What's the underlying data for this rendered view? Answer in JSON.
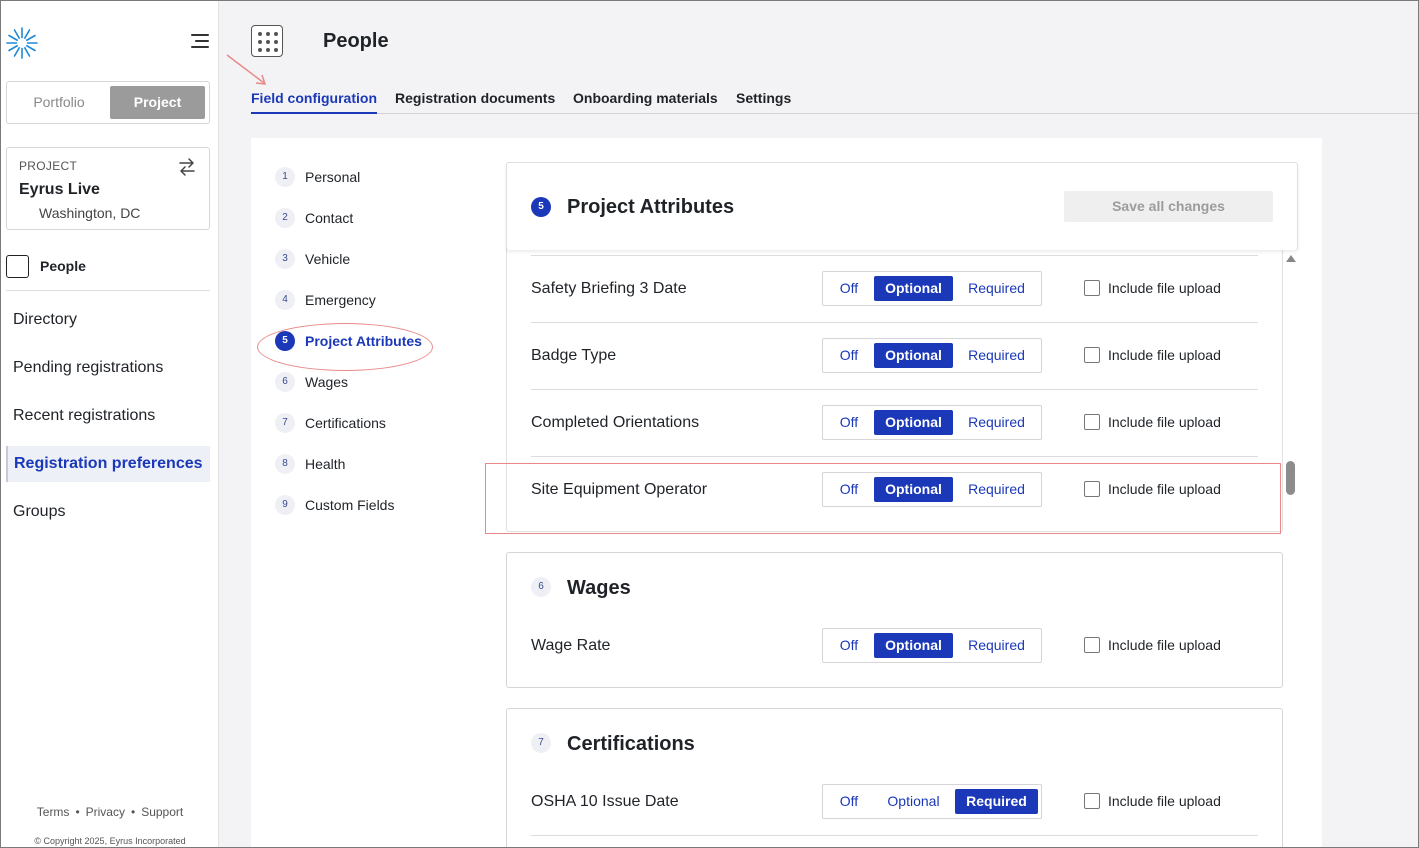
{
  "sidebar": {
    "switcher": {
      "portfolio": "Portfolio",
      "project": "Project"
    },
    "project_card": {
      "label": "PROJECT",
      "name": "Eyrus Live",
      "location": "Washington, DC"
    },
    "module": "People",
    "nav": [
      "Directory",
      "Pending registrations",
      "Recent registrations",
      "Registration preferences",
      "Groups"
    ],
    "active_nav": "Registration preferences",
    "footer": {
      "terms": "Terms",
      "privacy": "Privacy",
      "support": "Support",
      "copyright": "© Copyright 2025, Eyrus Incorporated"
    }
  },
  "header": {
    "title": "People",
    "tabs": [
      "Field configuration",
      "Registration documents",
      "Onboarding materials",
      "Settings"
    ],
    "active_tab": "Field configuration"
  },
  "steps": [
    {
      "num": "1",
      "name": "Personal"
    },
    {
      "num": "2",
      "name": "Contact"
    },
    {
      "num": "3",
      "name": "Vehicle"
    },
    {
      "num": "4",
      "name": "Emergency"
    },
    {
      "num": "5",
      "name": "Project Attributes"
    },
    {
      "num": "6",
      "name": "Wages"
    },
    {
      "num": "7",
      "name": "Certifications"
    },
    {
      "num": "8",
      "name": "Health"
    },
    {
      "num": "9",
      "name": "Custom Fields"
    }
  ],
  "active_step": "Project Attributes",
  "save_button": "Save all changes",
  "toggle_labels": {
    "off": "Off",
    "optional": "Optional",
    "required": "Required"
  },
  "checkbox_label": "Include file upload",
  "sections": {
    "project_attributes": {
      "num": "5",
      "title": "Project Attributes",
      "rows": [
        {
          "field": "Safety Briefing 3 Date",
          "selected": "Optional",
          "file_upload": false
        },
        {
          "field": "Badge Type",
          "selected": "Optional",
          "file_upload": false
        },
        {
          "field": "Completed Orientations",
          "selected": "Optional",
          "file_upload": false
        },
        {
          "field": "Site Equipment Operator",
          "selected": "Optional",
          "file_upload": false
        }
      ]
    },
    "wages": {
      "num": "6",
      "title": "Wages",
      "rows": [
        {
          "field": "Wage Rate",
          "selected": "Optional",
          "file_upload": false
        }
      ]
    },
    "certifications": {
      "num": "7",
      "title": "Certifications",
      "rows": [
        {
          "field": "OSHA 10 Issue Date",
          "selected": "Required",
          "file_upload": false
        }
      ]
    }
  },
  "colors": {
    "accent": "#1a38b8",
    "annotation": "#e88a8a"
  }
}
